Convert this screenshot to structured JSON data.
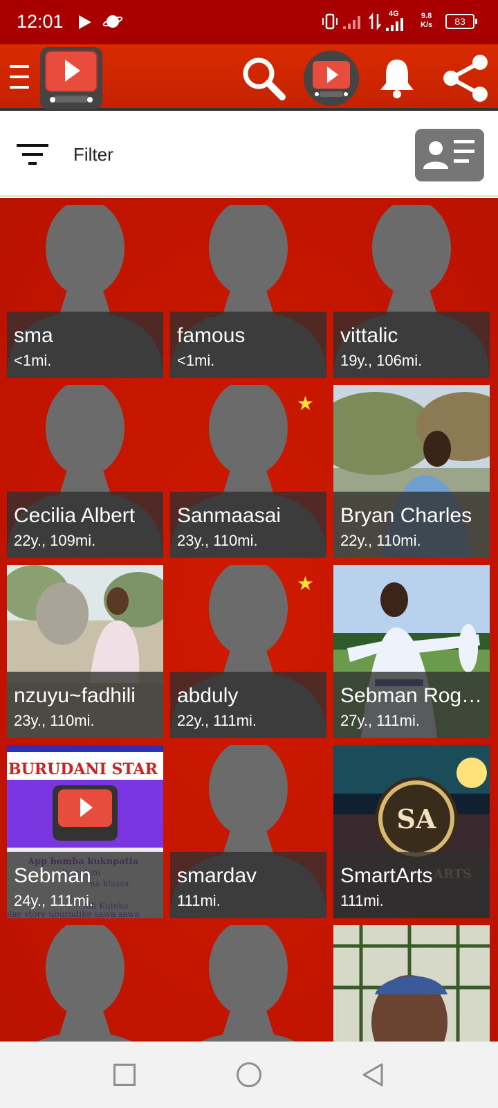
{
  "status_bar": {
    "time": "12:01",
    "network_type": "4G",
    "speed_value": "9.8",
    "speed_unit": "K/s",
    "battery": "83"
  },
  "app_bar": {
    "icons": [
      "menu-icon",
      "app-logo-icon",
      "search-icon",
      "channel-icon",
      "bell-icon",
      "share-icon"
    ]
  },
  "filter": {
    "label": "Filter"
  },
  "profiles": [
    {
      "name": "sma",
      "meta": "<1mi.",
      "photo": false,
      "starred": false
    },
    {
      "name": "famous",
      "meta": "<1mi.",
      "photo": false,
      "starred": false
    },
    {
      "name": "vittalic",
      "meta": "19y., 106mi.",
      "photo": false,
      "starred": false
    },
    {
      "name": "Cecilia Albert",
      "meta": "22y., 109mi.",
      "photo": false,
      "starred": false
    },
    {
      "name": "Sanmaasai",
      "meta": "23y., 110mi.",
      "photo": false,
      "starred": true
    },
    {
      "name": "Bryan Charles",
      "meta": "22y., 110mi.",
      "photo": true,
      "starred": false
    },
    {
      "name": "nzuyu~fadhili",
      "meta": "23y., 110mi.",
      "photo": true,
      "starred": false
    },
    {
      "name": "abduly",
      "meta": "22y., 111mi.",
      "photo": false,
      "starred": true
    },
    {
      "name": "Sebman Rogers",
      "meta": "27y., 111mi.",
      "photo": true,
      "starred": false
    },
    {
      "name": "Sebman",
      "meta": "24y., 111mi.",
      "photo": true,
      "starred": false
    },
    {
      "name": "smardav",
      "meta": "111mi.",
      "photo": false,
      "starred": false
    },
    {
      "name": "SmartArts",
      "meta": "111mi.",
      "photo": true,
      "starred": false
    },
    {
      "name": "",
      "meta": "",
      "photo": false,
      "starred": false
    },
    {
      "name": "",
      "meta": "",
      "photo": false,
      "starred": false
    },
    {
      "name": "",
      "meta": "",
      "photo": true,
      "starred": false
    }
  ],
  "photo_text": {
    "banner_title": "BURUDANI STAR",
    "banner_line1": "App bomba kukupatia",
    "banner_line2": "burudani",
    "banner_line3": "na kisasa",
    "banner_line4": "hili Kuteka",
    "banner_line5": "play store uburudike sawa sawa",
    "logo_text": "SA",
    "logo_subtext": "ARTS"
  },
  "colors": {
    "status_bar": "#a80000",
    "app_bar": "#d92a00",
    "grid_background": "#c41500",
    "silhouette": "#6b6b6b",
    "star": "#ffe033"
  },
  "nav_bar": {
    "icons": [
      "recent-apps-icon",
      "home-icon",
      "back-icon"
    ]
  }
}
